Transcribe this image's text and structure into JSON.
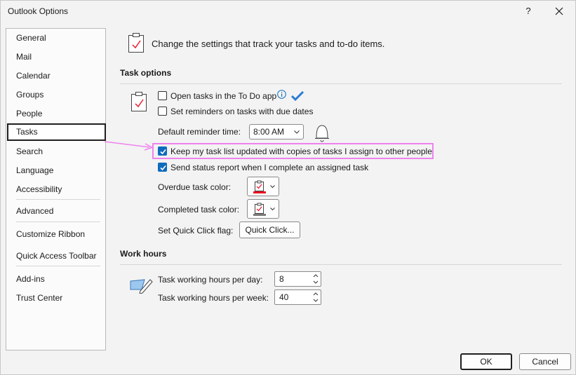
{
  "window": {
    "title": "Outlook Options",
    "help_label": "?",
    "close_label": "Close"
  },
  "nav": {
    "items": [
      {
        "label": "General"
      },
      {
        "label": "Mail"
      },
      {
        "label": "Calendar"
      },
      {
        "label": "Groups"
      },
      {
        "label": "People"
      },
      {
        "label": "Tasks",
        "selected": true
      },
      {
        "label": "Search"
      },
      {
        "label": "Language"
      },
      {
        "label": "Accessibility"
      },
      {
        "label": "Advanced"
      },
      {
        "label": "Customize Ribbon"
      },
      {
        "label": "Quick Access Toolbar"
      },
      {
        "label": "Add-ins"
      },
      {
        "label": "Trust Center"
      }
    ]
  },
  "header": {
    "description": "Change the settings that track your tasks and to-do items."
  },
  "task_options": {
    "title": "Task options",
    "open_in_todo": {
      "label": "Open tasks in the To Do app",
      "checked": false
    },
    "set_reminders": {
      "label": "Set reminders on tasks with due dates",
      "checked": false
    },
    "default_reminder": {
      "label": "Default reminder time:",
      "value": "8:00 AM"
    },
    "keep_updated": {
      "label": "Keep my task list updated with copies of tasks I assign to other people",
      "checked": true
    },
    "send_status": {
      "label": "Send status report when I complete an assigned task",
      "checked": true
    },
    "overdue_color": {
      "label": "Overdue task color:",
      "color": "#e81123"
    },
    "completed_color": {
      "label": "Completed task color:",
      "color": "#7a7a7a"
    },
    "quick_click": {
      "label": "Set Quick Click flag:",
      "button_label": "Quick Click..."
    }
  },
  "work_hours": {
    "title": "Work hours",
    "per_day": {
      "label": "Task working hours per day:",
      "value": "8"
    },
    "per_week": {
      "label": "Task working hours per week:",
      "value": "40"
    }
  },
  "footer": {
    "ok_label": "OK",
    "cancel_label": "Cancel"
  },
  "colors": {
    "accent": "#0f6cbd",
    "annotation": "#ee82ee"
  }
}
